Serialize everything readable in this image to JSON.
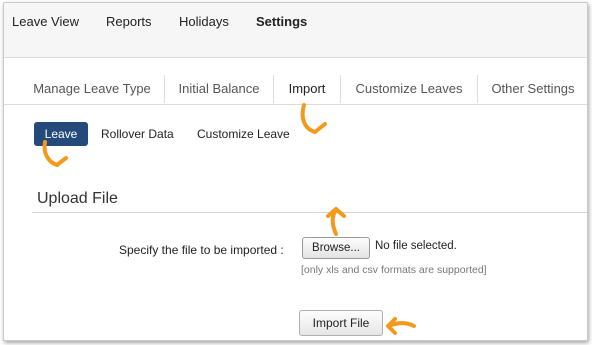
{
  "top_nav": {
    "items": [
      {
        "label": "Leave View"
      },
      {
        "label": "Reports"
      },
      {
        "label": "Holidays"
      },
      {
        "label": "Settings"
      }
    ],
    "active": "Settings"
  },
  "sub_tabs": {
    "items": [
      {
        "label": "Manage Leave Type"
      },
      {
        "label": "Initial Balance"
      },
      {
        "label": "Import"
      },
      {
        "label": "Customize Leaves"
      },
      {
        "label": "Other Settings"
      }
    ],
    "active": "Import"
  },
  "pills": {
    "items": [
      {
        "label": "Leave"
      },
      {
        "label": "Rollover Data"
      },
      {
        "label": "Customize Leave"
      }
    ],
    "active": "Leave"
  },
  "upload": {
    "title": "Upload File",
    "file_label": "Specify the file to be imported :",
    "browse_label": "Browse...",
    "no_file_text": "No file selected.",
    "hint": "[only xls and csv formats are supported]",
    "import_label": "Import File"
  },
  "colors": {
    "accent": "#234a7a",
    "highlight_arrow": "#f39a1c"
  },
  "icons": [
    "curved-arrow-icon"
  ]
}
